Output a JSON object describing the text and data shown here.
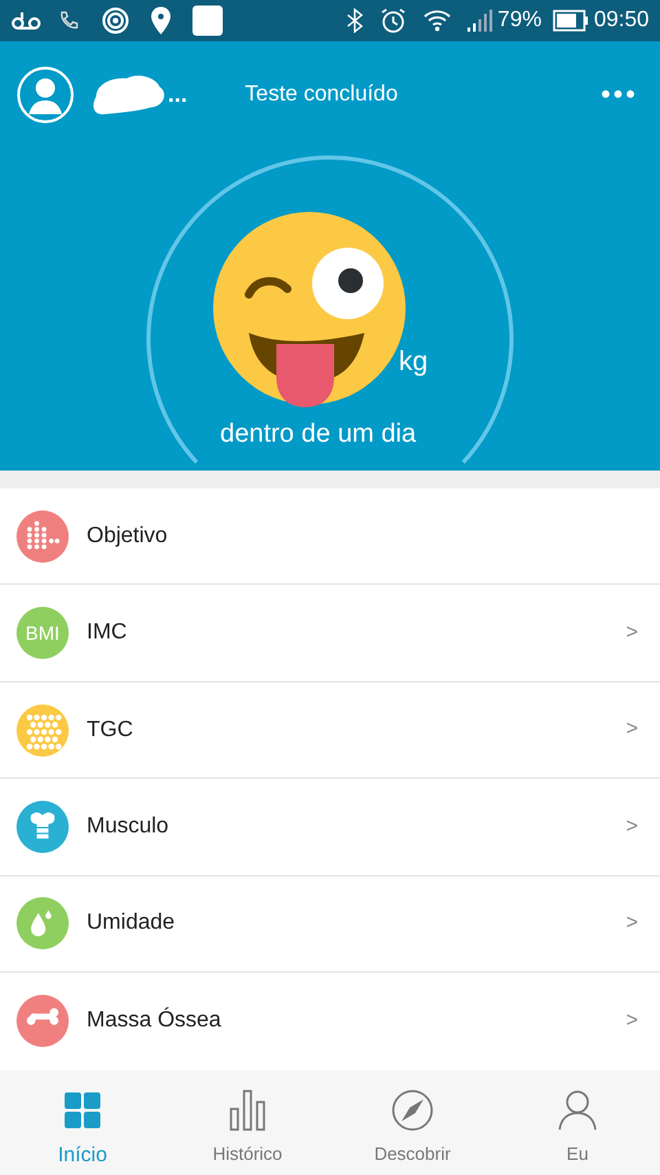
{
  "status_bar": {
    "battery": "79%",
    "time": "09:50"
  },
  "header": {
    "name_suffix": "...",
    "title": "Teste concluído",
    "menu": "•••"
  },
  "gauge": {
    "unit": "kg",
    "caption": "dentro de um dia"
  },
  "metrics": [
    {
      "kind": "goal",
      "label": "Objetivo",
      "color": "#f08080"
    },
    {
      "kind": "bmi",
      "label": "IMC",
      "badge": "BMI",
      "chevron": ">",
      "color": "#8fcf5f"
    },
    {
      "kind": "fat",
      "label": "TGC",
      "chevron": ">",
      "color": "#fbc943"
    },
    {
      "kind": "muscle",
      "label": "Musculo",
      "chevron": ">",
      "color": "#2ab0d3"
    },
    {
      "kind": "water",
      "label": "Umidade",
      "chevron": ">",
      "color": "#8fcf5f"
    },
    {
      "kind": "bone",
      "label": "Massa Óssea",
      "chevron": ">",
      "color": "#f08080"
    }
  ],
  "nav": [
    {
      "kind": "home",
      "label": "Início",
      "selected": true
    },
    {
      "kind": "history",
      "label": "Histórico",
      "selected": false
    },
    {
      "kind": "discover",
      "label": "Descobrir",
      "selected": false
    },
    {
      "kind": "me",
      "label": "Eu",
      "selected": false
    }
  ]
}
